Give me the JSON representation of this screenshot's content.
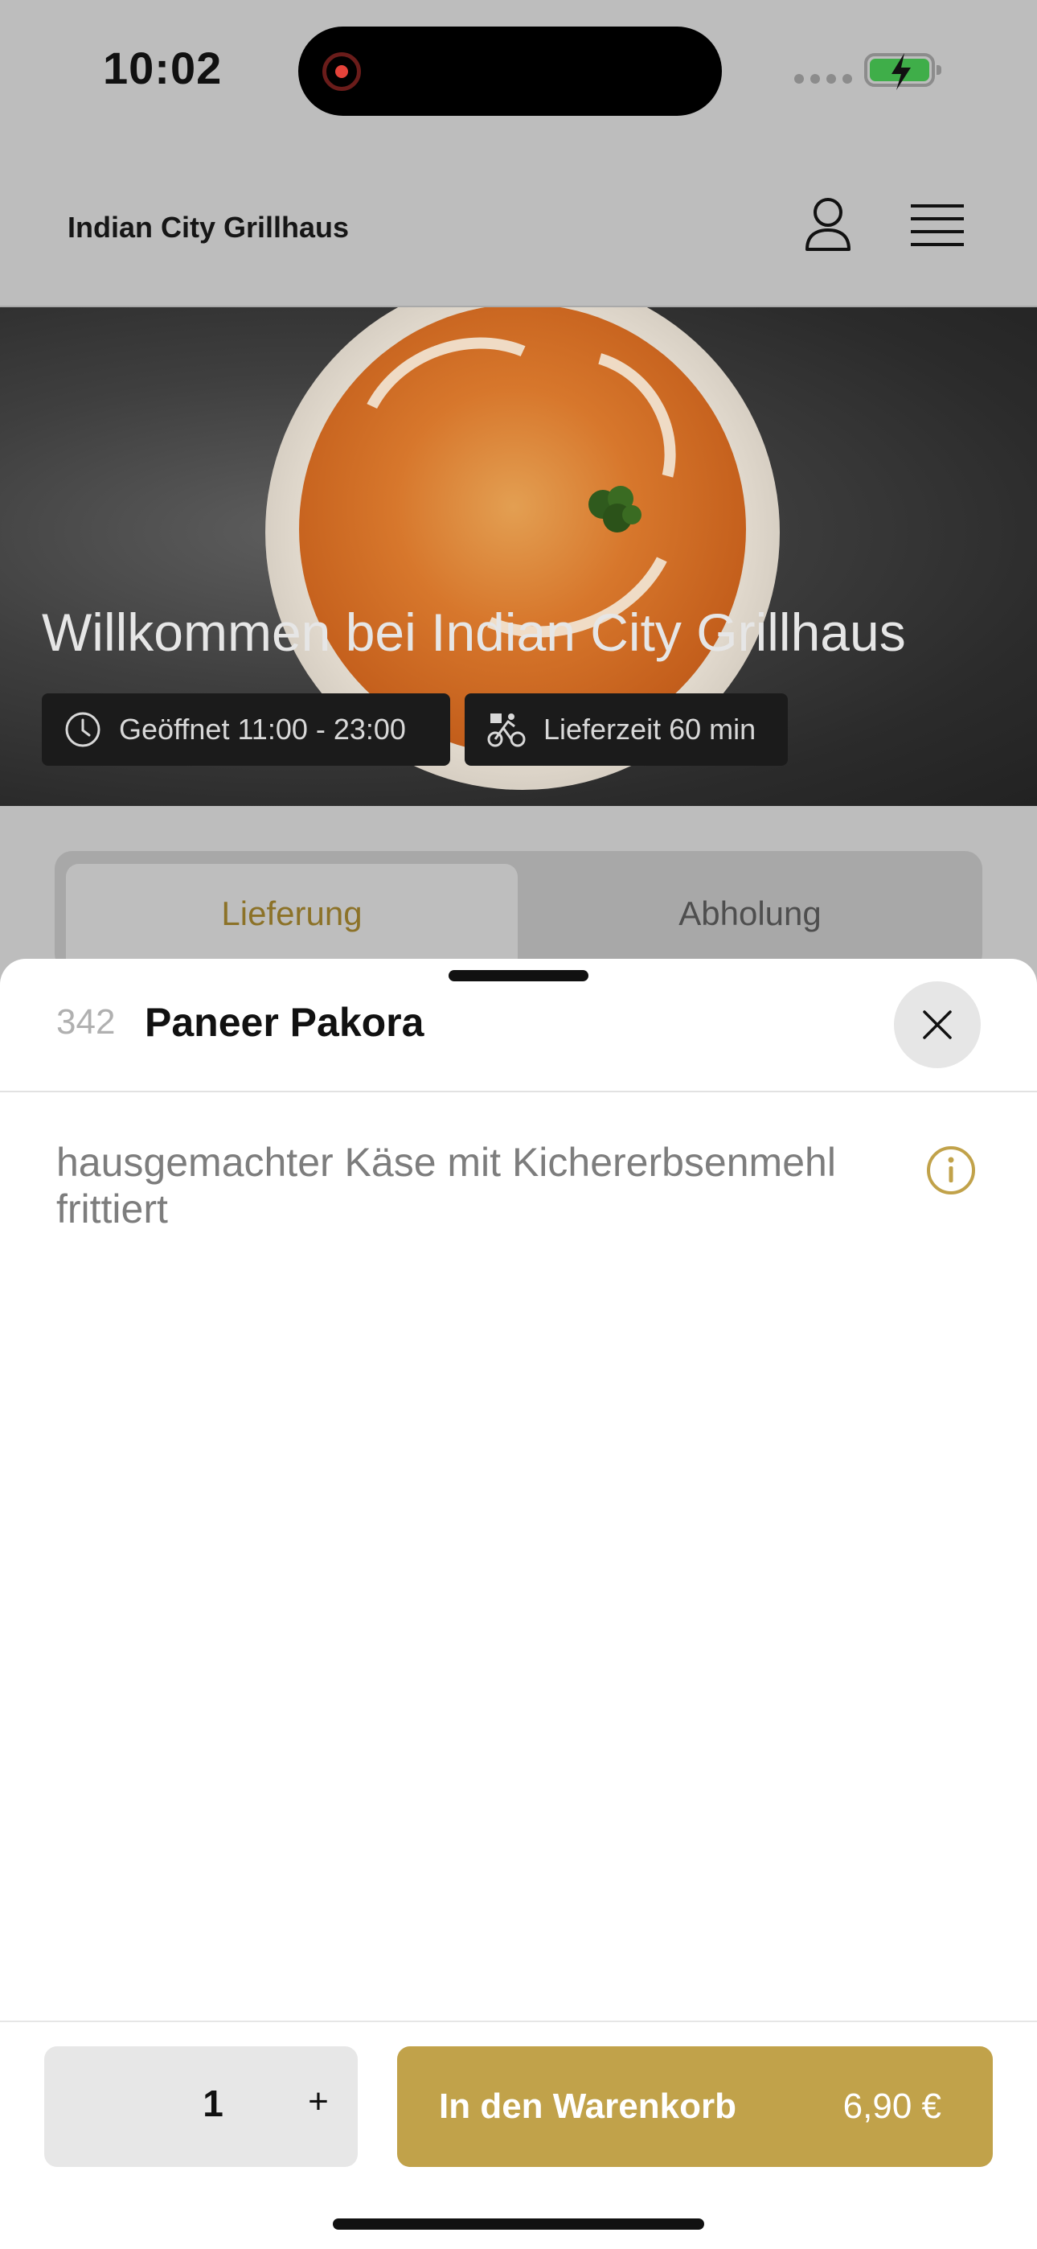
{
  "status_bar": {
    "time": "10:02"
  },
  "header": {
    "title": "Indian City Grillhaus"
  },
  "hero": {
    "title": "Willkommen bei Indian City Grillhaus",
    "opening_hours": "Geöffnet 11:00 - 23:00",
    "delivery_time": "Lieferzeit 60 min"
  },
  "tabs": [
    {
      "label": "Lieferung",
      "active": true
    },
    {
      "label": "Abholung",
      "active": false
    }
  ],
  "item": {
    "number": "342",
    "name": "Paneer Pakora",
    "description": "hausgemachter Käse mit Kichererbsenmehl frittiert"
  },
  "order": {
    "quantity": "1",
    "plus": "+",
    "add_to_cart": "In den Warenkorb",
    "price": "6,90 €"
  },
  "colors": {
    "accent": "#c1a24a",
    "overlay_gray": "#bdbdbd",
    "sheet": "#ffffff"
  },
  "icons": [
    "record-icon",
    "signal-icon",
    "battery-icon",
    "user-icon",
    "menu-icon",
    "clock-icon",
    "bike-icon",
    "close-icon",
    "info-icon"
  ]
}
